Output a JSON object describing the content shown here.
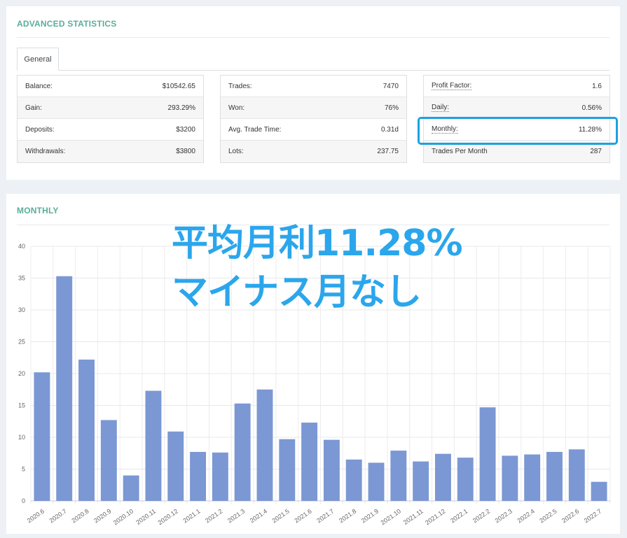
{
  "advanced_statistics": {
    "title": "ADVANCED STATISTICS",
    "tabs": [
      {
        "label": "General"
      }
    ],
    "columns": [
      [
        {
          "label": "Balance:",
          "value": "$10542.65"
        },
        {
          "label": "Gain:",
          "value": "293.29%"
        },
        {
          "label": "Deposits:",
          "value": "$3200"
        },
        {
          "label": "Withdrawals:",
          "value": "$3800"
        }
      ],
      [
        {
          "label": "Trades:",
          "value": "7470"
        },
        {
          "label": "Won:",
          "value": "76%"
        },
        {
          "label": "Avg. Trade Time:",
          "value": "0.31d"
        },
        {
          "label": "Lots:",
          "value": "237.75"
        }
      ],
      [
        {
          "label": "Profit Factor:",
          "value": "1.6"
        },
        {
          "label": "Daily:",
          "value": "0.56%"
        },
        {
          "label": "Monthly:",
          "value": "11.28%"
        },
        {
          "label": "Trades Per Month",
          "value": "287"
        }
      ]
    ],
    "highlight_color": "#1da1e0"
  },
  "monthly": {
    "title": "MONTHLY"
  },
  "overlay": {
    "line1": "平均月利11.28%",
    "line2": "マイナス月なし",
    "color": "#2ba6ec"
  },
  "chart_data": {
    "type": "bar",
    "title": "",
    "xlabel": "",
    "ylabel": "",
    "ylim": [
      0,
      40
    ],
    "yticks": [
      0,
      5,
      10,
      15,
      20,
      25,
      30,
      35,
      40
    ],
    "grid": true,
    "bar_color": "#7b98d4",
    "categories": [
      "2020.6",
      "2020.7",
      "2020.8",
      "2020.9",
      "2020.10",
      "2020.11",
      "2020.12",
      "2021.1",
      "2021.2",
      "2021.3",
      "2021.4",
      "2021.5",
      "2021.6",
      "2021.7",
      "2021.8",
      "2021.9",
      "2021.10",
      "2021.11",
      "2021.12",
      "2022.1",
      "2022.2",
      "2022.3",
      "2022.4",
      "2022.5",
      "2022.6",
      "2022.7"
    ],
    "values": [
      20.2,
      35.3,
      22.2,
      12.7,
      4.0,
      17.3,
      10.9,
      7.7,
      7.6,
      15.3,
      17.5,
      9.7,
      12.3,
      9.6,
      6.5,
      6.0,
      7.9,
      6.2,
      7.4,
      6.8,
      14.7,
      7.1,
      7.3,
      7.7,
      8.1,
      3.0
    ]
  }
}
